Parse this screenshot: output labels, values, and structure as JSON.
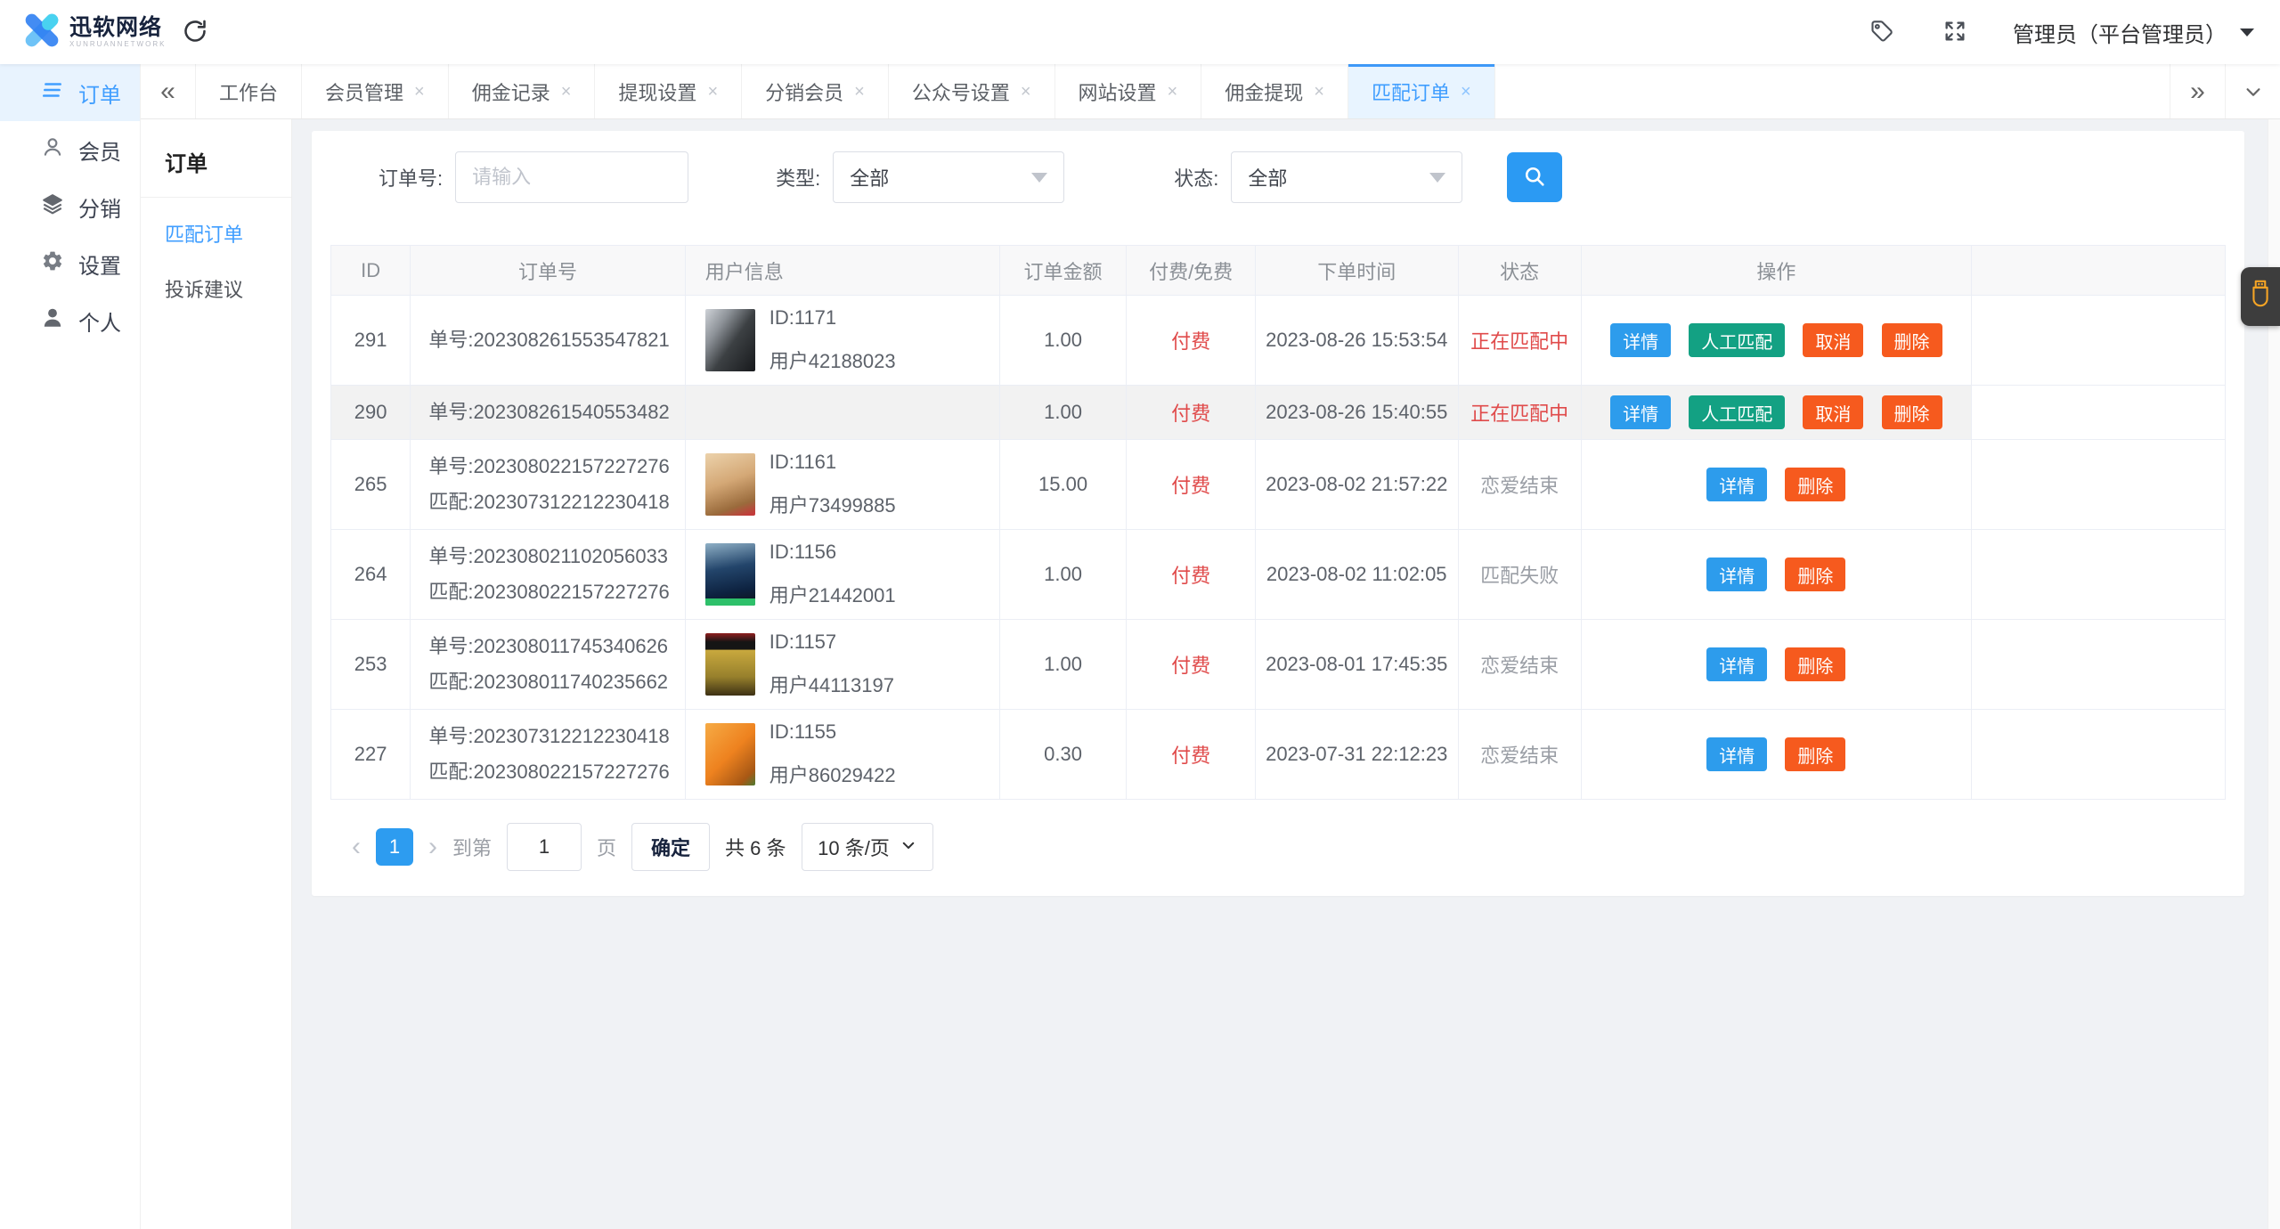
{
  "topbar": {
    "logo_text": "迅软网络",
    "logo_subtext": "XUNRUANNETWORK",
    "user_label": "管理员（平台管理员）"
  },
  "sidebar": {
    "items": [
      {
        "label": "订单",
        "icon": "order-list-icon",
        "active": true
      },
      {
        "label": "会员",
        "icon": "member-icon",
        "active": false
      },
      {
        "label": "分销",
        "icon": "distribution-icon",
        "active": false
      },
      {
        "label": "设置",
        "icon": "settings-icon",
        "active": false
      },
      {
        "label": "个人",
        "icon": "profile-icon",
        "active": false
      }
    ]
  },
  "tabs": [
    {
      "label": "工作台",
      "closable": false,
      "active": false
    },
    {
      "label": "会员管理",
      "closable": true,
      "active": false
    },
    {
      "label": "佣金记录",
      "closable": true,
      "active": false
    },
    {
      "label": "提现设置",
      "closable": true,
      "active": false
    },
    {
      "label": "分销会员",
      "closable": true,
      "active": false
    },
    {
      "label": "公众号设置",
      "closable": true,
      "active": false
    },
    {
      "label": "网站设置",
      "closable": true,
      "active": false
    },
    {
      "label": "佣金提现",
      "closable": true,
      "active": false
    },
    {
      "label": "匹配订单",
      "closable": true,
      "active": true
    }
  ],
  "submenu": {
    "title": "订单",
    "items": [
      {
        "label": "匹配订单",
        "active": true
      },
      {
        "label": "投诉建议",
        "active": false
      }
    ]
  },
  "filters": {
    "order_no_label": "订单号:",
    "order_no_placeholder": "请输入",
    "type_label": "类型:",
    "type_value": "全部",
    "status_label": "状态:",
    "status_value": "全部"
  },
  "table": {
    "headers": [
      "ID",
      "订单号",
      "用户信息",
      "订单金额",
      "付费/免费",
      "下单时间",
      "状态",
      "操作"
    ],
    "rows": [
      {
        "id": "291",
        "order_no": "单号:202308261553547821",
        "match_no": "",
        "avatar": "anime-dark",
        "user_id": "ID:1171",
        "user_name": "用户42188023",
        "amount": "1.00",
        "fee": "付费",
        "time": "2023-08-26 15:53:54",
        "status": "正在匹配中",
        "status_type": "danger",
        "highlighted": false,
        "actions": [
          "详情",
          "人工匹配",
          "取消",
          "删除"
        ]
      },
      {
        "id": "290",
        "order_no": "单号:202308261540553482",
        "match_no": "",
        "avatar": "",
        "user_id": "",
        "user_name": "",
        "amount": "1.00",
        "fee": "付费",
        "time": "2023-08-26 15:40:55",
        "status": "正在匹配中",
        "status_type": "danger",
        "highlighted": true,
        "actions": [
          "详情",
          "人工匹配",
          "取消",
          "删除"
        ]
      },
      {
        "id": "265",
        "order_no": "单号:202308022157227276",
        "match_no": "匹配:202307312212230418",
        "avatar": "dog-tan",
        "user_id": "ID:1161",
        "user_name": "用户73499885",
        "amount": "15.00",
        "fee": "付费",
        "time": "2023-08-02 21:57:22",
        "status": "恋爱结束",
        "status_type": "muted",
        "highlighted": false,
        "actions": [
          "详情",
          "删除"
        ]
      },
      {
        "id": "264",
        "order_no": "单号:202308021102056033",
        "match_no": "匹配:202308022157227276",
        "avatar": "poster-blue",
        "user_id": "ID:1156",
        "user_name": "用户21442001",
        "amount": "1.00",
        "fee": "付费",
        "time": "2023-08-02 11:02:05",
        "status": "匹配失败",
        "status_type": "muted",
        "highlighted": false,
        "actions": [
          "详情",
          "删除"
        ]
      },
      {
        "id": "253",
        "order_no": "单号:202308011745340626",
        "match_no": "匹配:202308011740235662",
        "avatar": "meme-yellow",
        "user_id": "ID:1157",
        "user_name": "用户44113197",
        "amount": "1.00",
        "fee": "付费",
        "time": "2023-08-01 17:45:35",
        "status": "恋爱结束",
        "status_type": "muted",
        "highlighted": false,
        "actions": [
          "详情",
          "删除"
        ]
      },
      {
        "id": "227",
        "order_no": "单号:202307312212230418",
        "match_no": "匹配:202308022157227276",
        "avatar": "garfield",
        "user_id": "ID:1155",
        "user_name": "用户86029422",
        "amount": "0.30",
        "fee": "付费",
        "time": "2023-07-31 22:12:23",
        "status": "恋爱结束",
        "status_type": "muted",
        "highlighted": false,
        "actions": [
          "详情",
          "删除"
        ]
      }
    ]
  },
  "pagination": {
    "prev": "‹",
    "current_page": "1",
    "next": "›",
    "goto_label": "到第",
    "goto_value": "1",
    "page_unit": "页",
    "confirm_label": "确定",
    "total_label": "共 6 条",
    "per_page_value": "10 条/页"
  },
  "colors": {
    "accent_blue": "#409eff",
    "button_blue": "#2d9cec",
    "button_green": "#13a183",
    "button_orange": "#f65a1e",
    "danger_red": "#e04b4b",
    "search_button_blue": "#2b9af3"
  }
}
